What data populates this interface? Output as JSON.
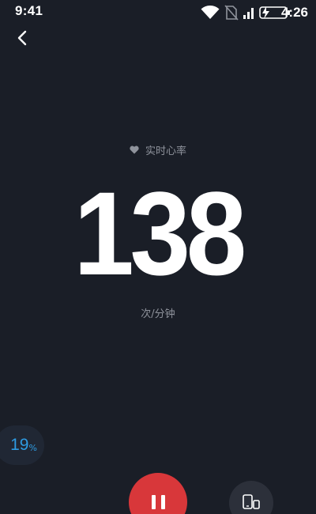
{
  "status_bar": {
    "time": "9:41",
    "right_time": "4:26",
    "icons": [
      "wifi-icon",
      "no-sim-icon",
      "signal-icon",
      "battery-charging-icon"
    ]
  },
  "header": {
    "back_icon": "chevron-left-icon"
  },
  "heart_rate": {
    "label": "实时心率",
    "label_icon": "heart-icon",
    "value": "138",
    "unit": "次/分钟"
  },
  "device_battery": {
    "value": "19",
    "unit": "%"
  },
  "controls": {
    "pause_icon": "pause-icon",
    "device_icon": "phone-watch-icon"
  },
  "colors": {
    "background": "#1a1e27",
    "accent_red": "#d8373a",
    "accent_blue": "#2e9be2",
    "secondary_text": "#8f939c"
  }
}
